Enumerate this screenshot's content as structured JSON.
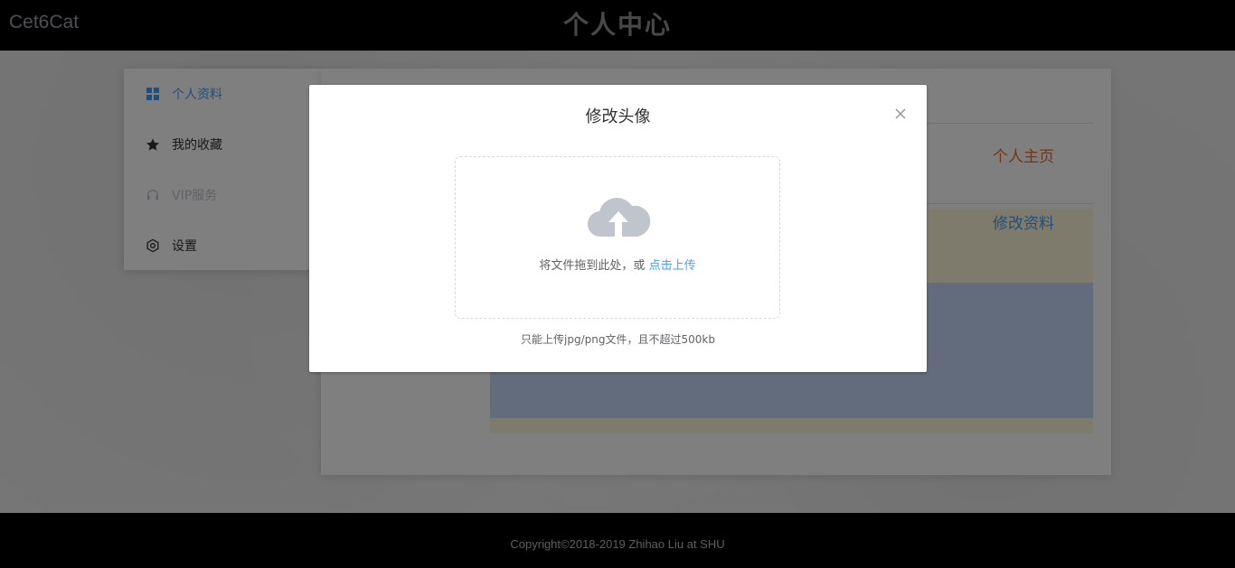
{
  "header": {
    "brand": "Cet6Cat",
    "title": "个人中心"
  },
  "sidebar": {
    "items": [
      {
        "label": "个人资料",
        "icon": "grid-icon",
        "state": "active"
      },
      {
        "label": "我的收藏",
        "icon": "star-icon",
        "state": "normal"
      },
      {
        "label": "VIP服务",
        "icon": "headset-icon",
        "state": "disabled"
      },
      {
        "label": "设置",
        "icon": "gear-icon",
        "state": "normal"
      }
    ]
  },
  "main": {
    "home_link": "个人主页",
    "edit_link": "修改资料"
  },
  "dialog": {
    "title": "修改头像",
    "drop_text": "将文件拖到此处，或",
    "drop_link": "点击上传",
    "tip": "只能上传jpg/png文件，且不超过500kb"
  },
  "footer": {
    "copyright": "Copyright©2018-2019 Zhihao Liu at SHU"
  },
  "colors": {
    "accent": "#409eff",
    "home_link": "#e8692d",
    "header_bg": "#000000"
  }
}
